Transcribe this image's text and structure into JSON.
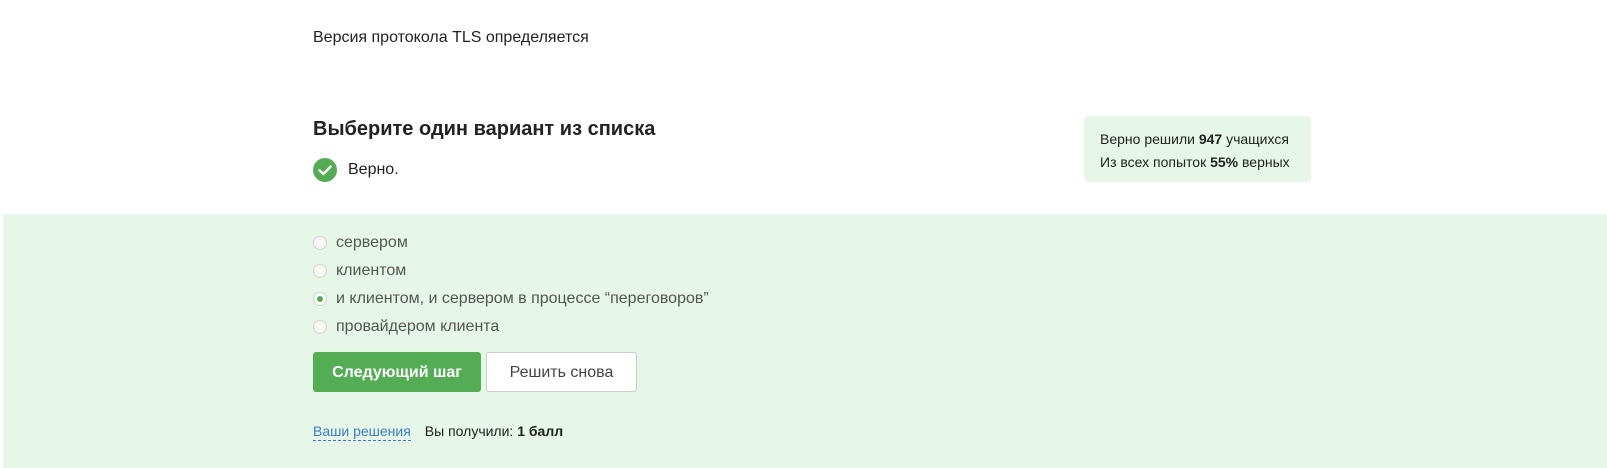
{
  "question": {
    "text": "Версия протокола TLS определяется"
  },
  "quiz": {
    "heading": "Выберите один вариант из списка",
    "verdict": "Верно.",
    "verdict_icon": "check-circle-icon",
    "accent_color": "#54ad54",
    "background_color": "#e6f6e8"
  },
  "stats": {
    "solved_prefix": "Верно решили",
    "solved_count": "947",
    "solved_suffix": "учащихся",
    "attempts_prefix": "Из всех попыток",
    "attempts_percent": "55%",
    "attempts_suffix": "верных"
  },
  "options": [
    {
      "label": "сервером",
      "selected": false
    },
    {
      "label": "клиентом",
      "selected": false
    },
    {
      "label": "и клиентом, и сервером в процессе “переговоров”",
      "selected": true
    },
    {
      "label": "провайдером клиента",
      "selected": false
    }
  ],
  "buttons": {
    "next_label": "Следующий шаг",
    "retry_label": "Решить снова"
  },
  "footer": {
    "solutions_link": "Ваши решения",
    "score_prefix": "Вы получили:",
    "score_value": "1 балл"
  }
}
